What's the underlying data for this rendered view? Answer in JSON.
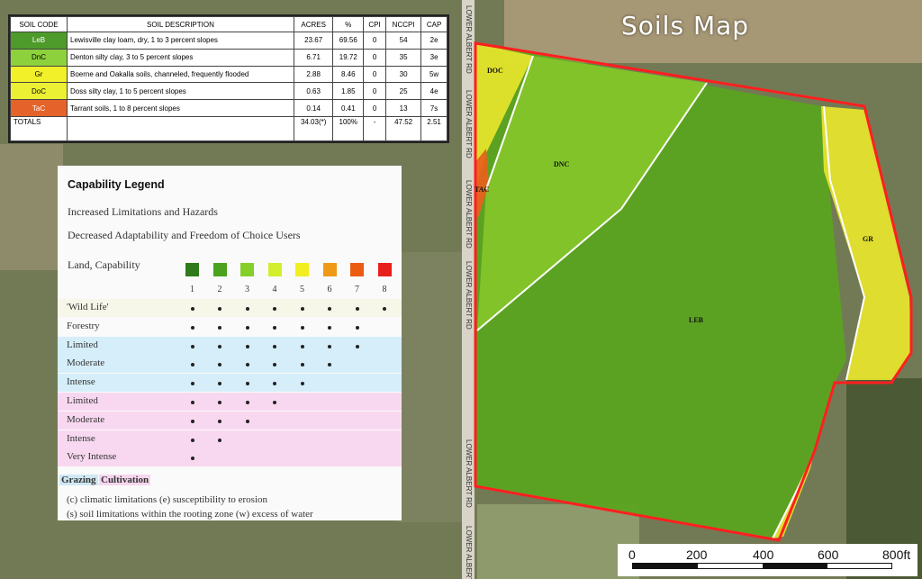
{
  "map": {
    "title": "Soils Map",
    "road_label": "LOWER ALBERT RD",
    "parcel_labels": {
      "doc": "DOC",
      "dnc": "DNC",
      "tac": "TAC",
      "gr": "GR",
      "leb": "LEB"
    },
    "colors": {
      "leb": "#5aa51e",
      "dnc": "#86c52b",
      "gr": "#e8e52c",
      "doc": "#e8e52c",
      "tac": "#e5631c",
      "boundary": "#ff1f1f"
    }
  },
  "soil_table": {
    "headers": [
      "SOIL CODE",
      "SOIL DESCRIPTION",
      "ACRES",
      "%",
      "CPI",
      "NCCPI",
      "CAP"
    ],
    "rows": [
      {
        "code": "LeB",
        "color": "#4e9a2a",
        "description": "Lewisville clay loam, dry, 1 to 3 percent slopes",
        "acres": "23.67",
        "pct": "69.56",
        "cpi": "0",
        "nccpi": "54",
        "cap": "2e"
      },
      {
        "code": "DnC",
        "color": "#8dd13c",
        "description": "Denton silty clay, 3 to 5 percent slopes",
        "acres": "6.71",
        "pct": "19.72",
        "cpi": "0",
        "nccpi": "35",
        "cap": "3e"
      },
      {
        "code": "Gr",
        "color": "#f2f028",
        "description": "Boerne and Oakalla soils, channeled, frequently flooded",
        "acres": "2.88",
        "pct": "8.46",
        "cpi": "0",
        "nccpi": "30",
        "cap": "5w"
      },
      {
        "code": "DoC",
        "color": "#ecf035",
        "description": "Doss silty clay, 1 to 5 percent slopes",
        "acres": "0.63",
        "pct": "1.85",
        "cpi": "0",
        "nccpi": "25",
        "cap": "4e"
      },
      {
        "code": "TaC",
        "color": "#e5632a",
        "description": "Tarrant soils, 1 to 8 percent slopes",
        "acres": "0.14",
        "pct": "0.41",
        "cpi": "0",
        "nccpi": "13",
        "cap": "7s"
      }
    ],
    "totals": {
      "label": "TOTALS",
      "description": "",
      "acres": "34.03(*)",
      "pct": "100%",
      "cpi": "-",
      "nccpi": "47.52",
      "cap": "2.51"
    }
  },
  "legend": {
    "title": "Capability Legend",
    "line1": "Increased Limitations and Hazards",
    "line2": "Decreased Adaptability and Freedom of Choice Users",
    "land_label": "Land, Capability",
    "classes": [
      {
        "num": "1",
        "color": "#2f7a1c"
      },
      {
        "num": "2",
        "color": "#4aa21e"
      },
      {
        "num": "3",
        "color": "#86cf2a"
      },
      {
        "num": "4",
        "color": "#d3ee2c"
      },
      {
        "num": "5",
        "color": "#f1ef22"
      },
      {
        "num": "6",
        "color": "#ee9a16"
      },
      {
        "num": "7",
        "color": "#ec5b12"
      },
      {
        "num": "8",
        "color": "#e8201c"
      }
    ],
    "rows": [
      {
        "label": "'Wild Life'",
        "count": 8,
        "bg": "#f6f7e8"
      },
      {
        "label": "Forestry",
        "count": 7,
        "bg": "#fafafa"
      },
      {
        "label": "Limited",
        "count": 7,
        "bg": "#d5eefa"
      },
      {
        "label": "Moderate",
        "count": 6,
        "bg": "#d5eefa"
      },
      {
        "label": "Intense",
        "count": 5,
        "bg": "#d5eefa"
      },
      {
        "label": "Limited",
        "count": 4,
        "bg": "#f8d8f0"
      },
      {
        "label": "Moderate",
        "count": 3,
        "bg": "#f8d8f0"
      },
      {
        "label": "Intense",
        "count": 2,
        "bg": "#f8d8f0"
      },
      {
        "label": "Very Intense",
        "count": 1,
        "bg": "#f8d8f0"
      }
    ],
    "grazing": "Grazing",
    "cultivation": "Cultivation",
    "note1": "(c) climatic limitations (e) susceptibility to erosion",
    "note2": "(s) soil limitations within the rooting zone (w) excess of water"
  },
  "scale": {
    "labels": [
      "0",
      "200",
      "400",
      "600",
      "800ft"
    ]
  }
}
